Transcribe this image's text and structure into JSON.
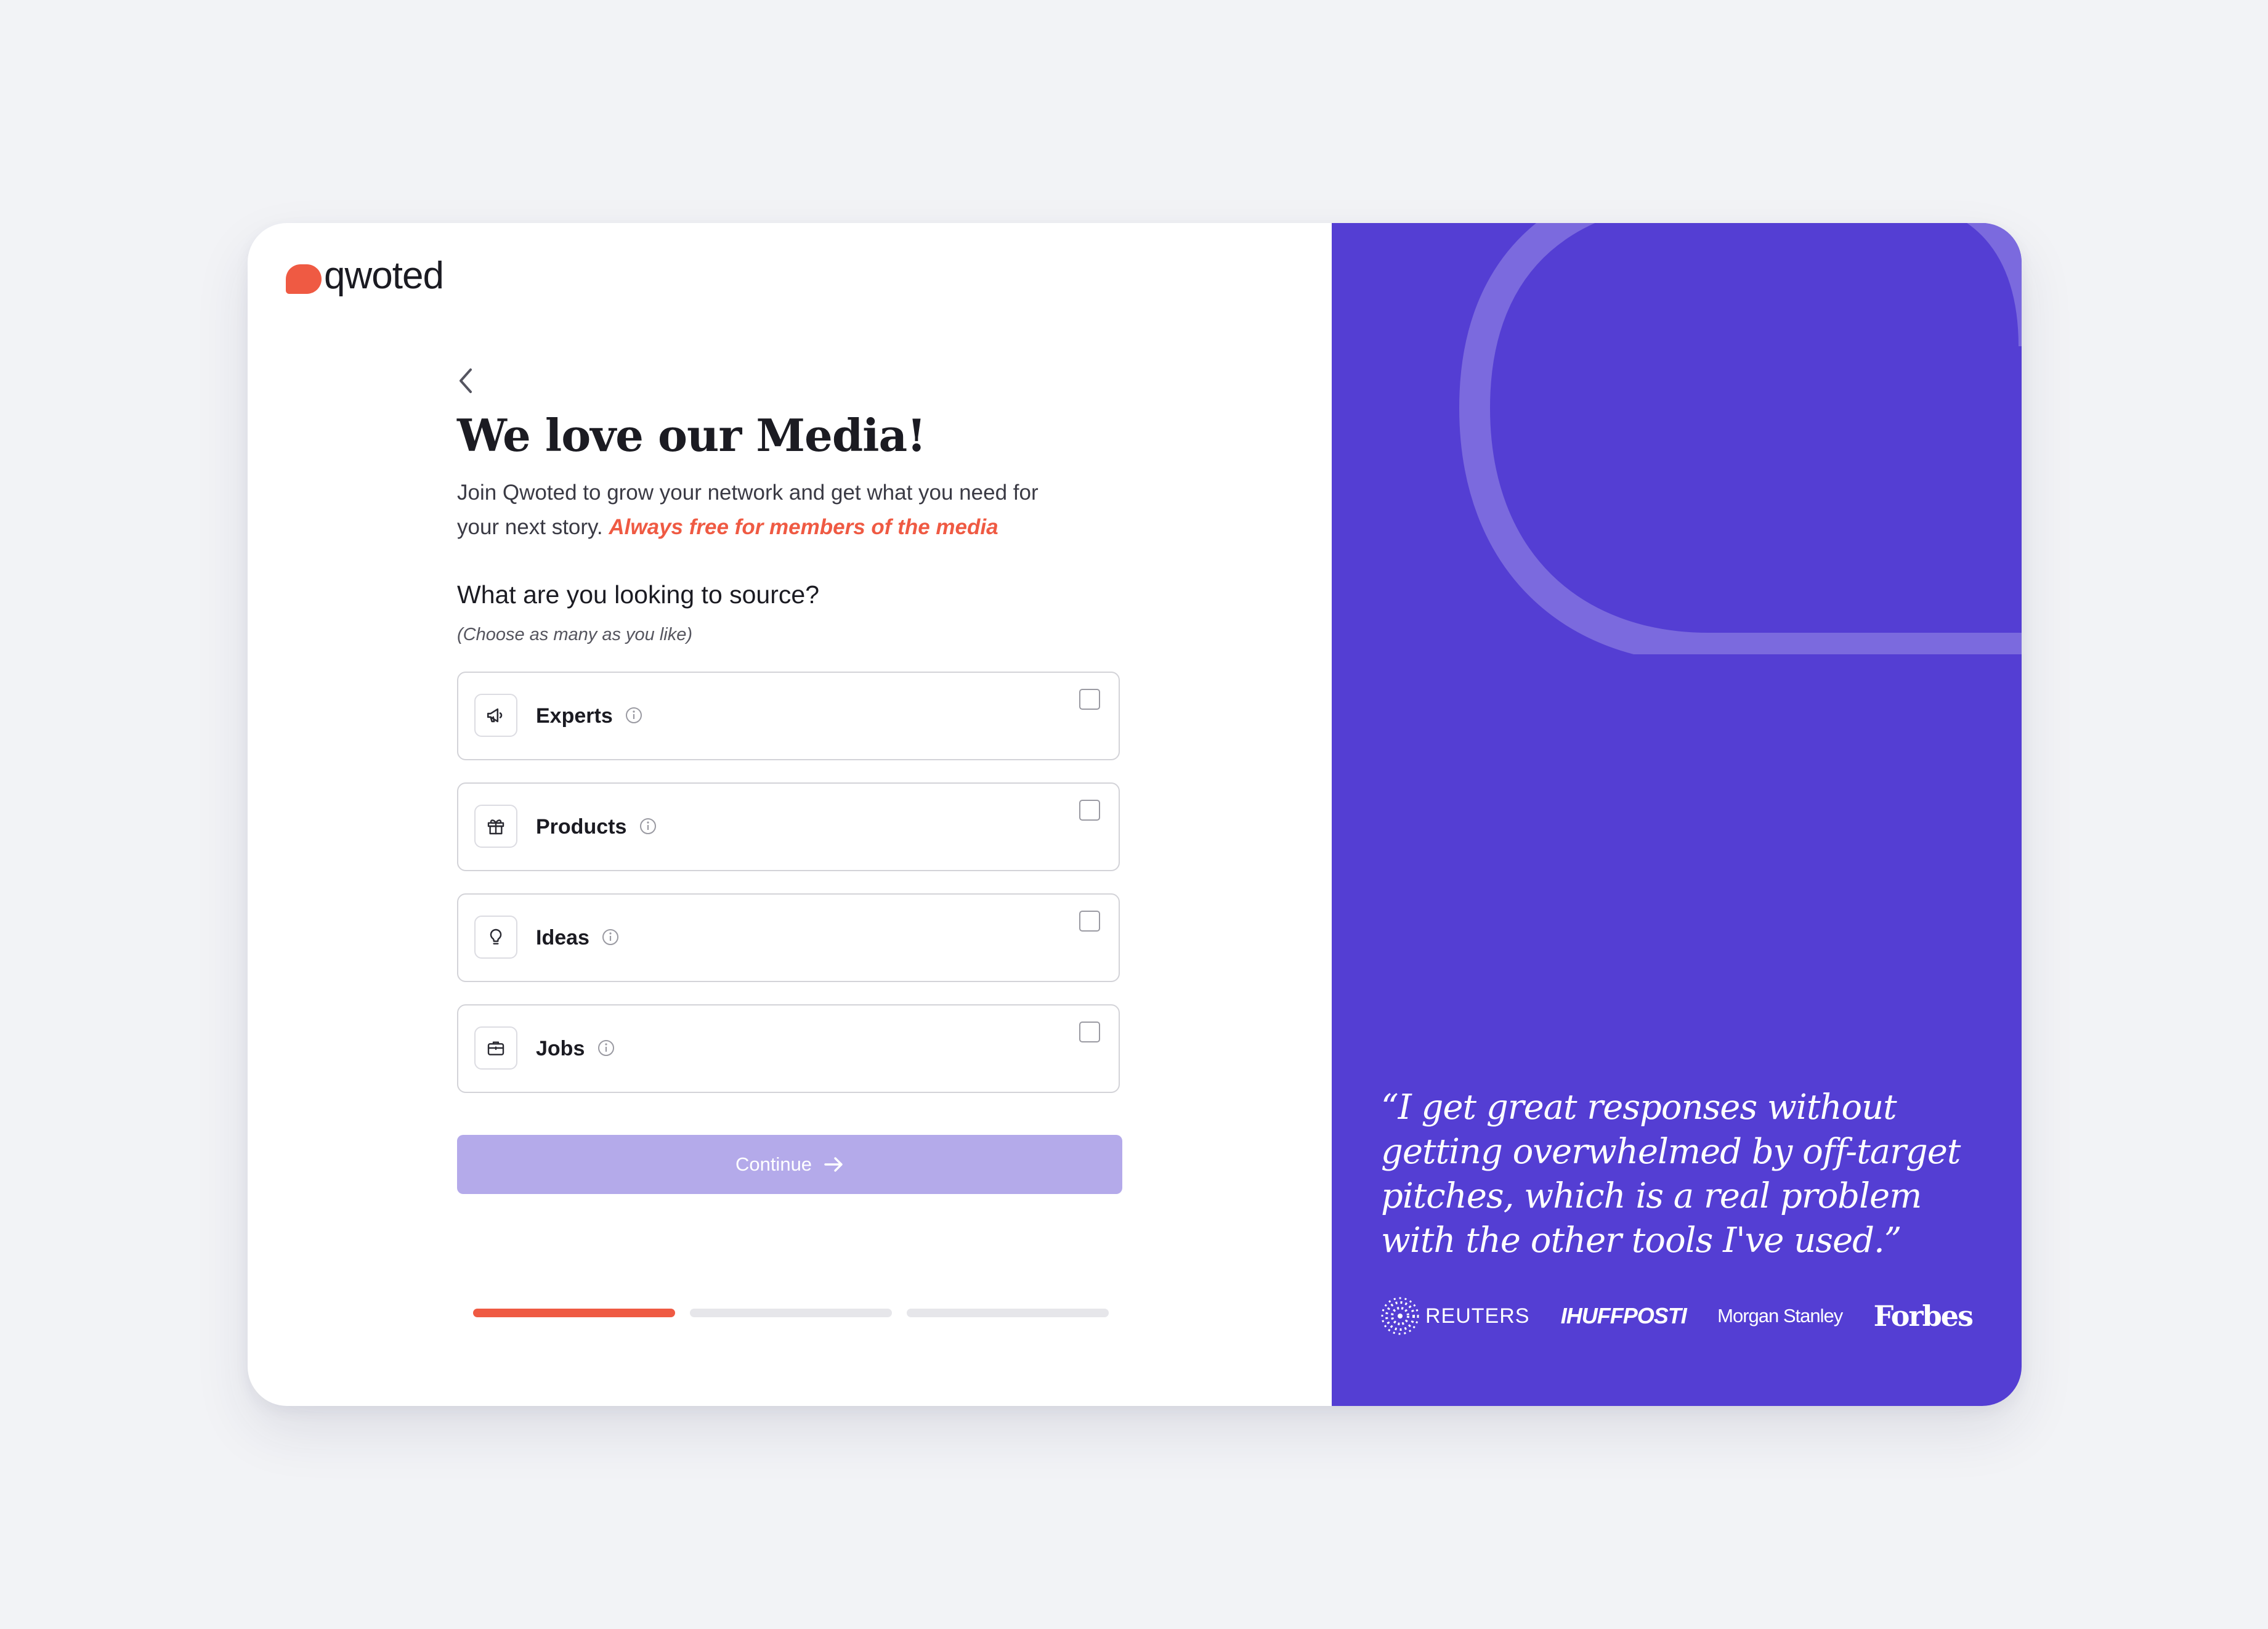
{
  "brand": {
    "name": "qwoted",
    "accent": "#ef5a43",
    "panel_color": "#543ed3"
  },
  "onboarding": {
    "back_icon": "chevron-left-icon",
    "title": "We love our Media!",
    "subtitle_main": "Join Qwoted to grow your network and get what you need for your next story.",
    "subtitle_accent": "Always free for members of the media",
    "question": "What are you looking to source?",
    "hint": "(Choose as many as you like)",
    "options": [
      {
        "label": "Experts",
        "icon": "megaphone-icon",
        "checked": false
      },
      {
        "label": "Products",
        "icon": "gift-icon",
        "checked": false
      },
      {
        "label": "Ideas",
        "icon": "lightbulb-icon",
        "checked": false
      },
      {
        "label": "Jobs",
        "icon": "briefcase-icon",
        "checked": false
      }
    ],
    "continue_label": "Continue",
    "continue_icon": "arrow-right-icon",
    "continue_enabled": false,
    "progress": {
      "current_step": 1,
      "total_steps": 3
    }
  },
  "testimonial": {
    "quote": "“I get great responses without getting overwhelmed by off-target pitches, which is a real problem with the other tools I've used.”",
    "logos": [
      "REUTERS",
      "IHUFFPOSTI",
      "Morgan Stanley",
      "Forbes"
    ]
  }
}
